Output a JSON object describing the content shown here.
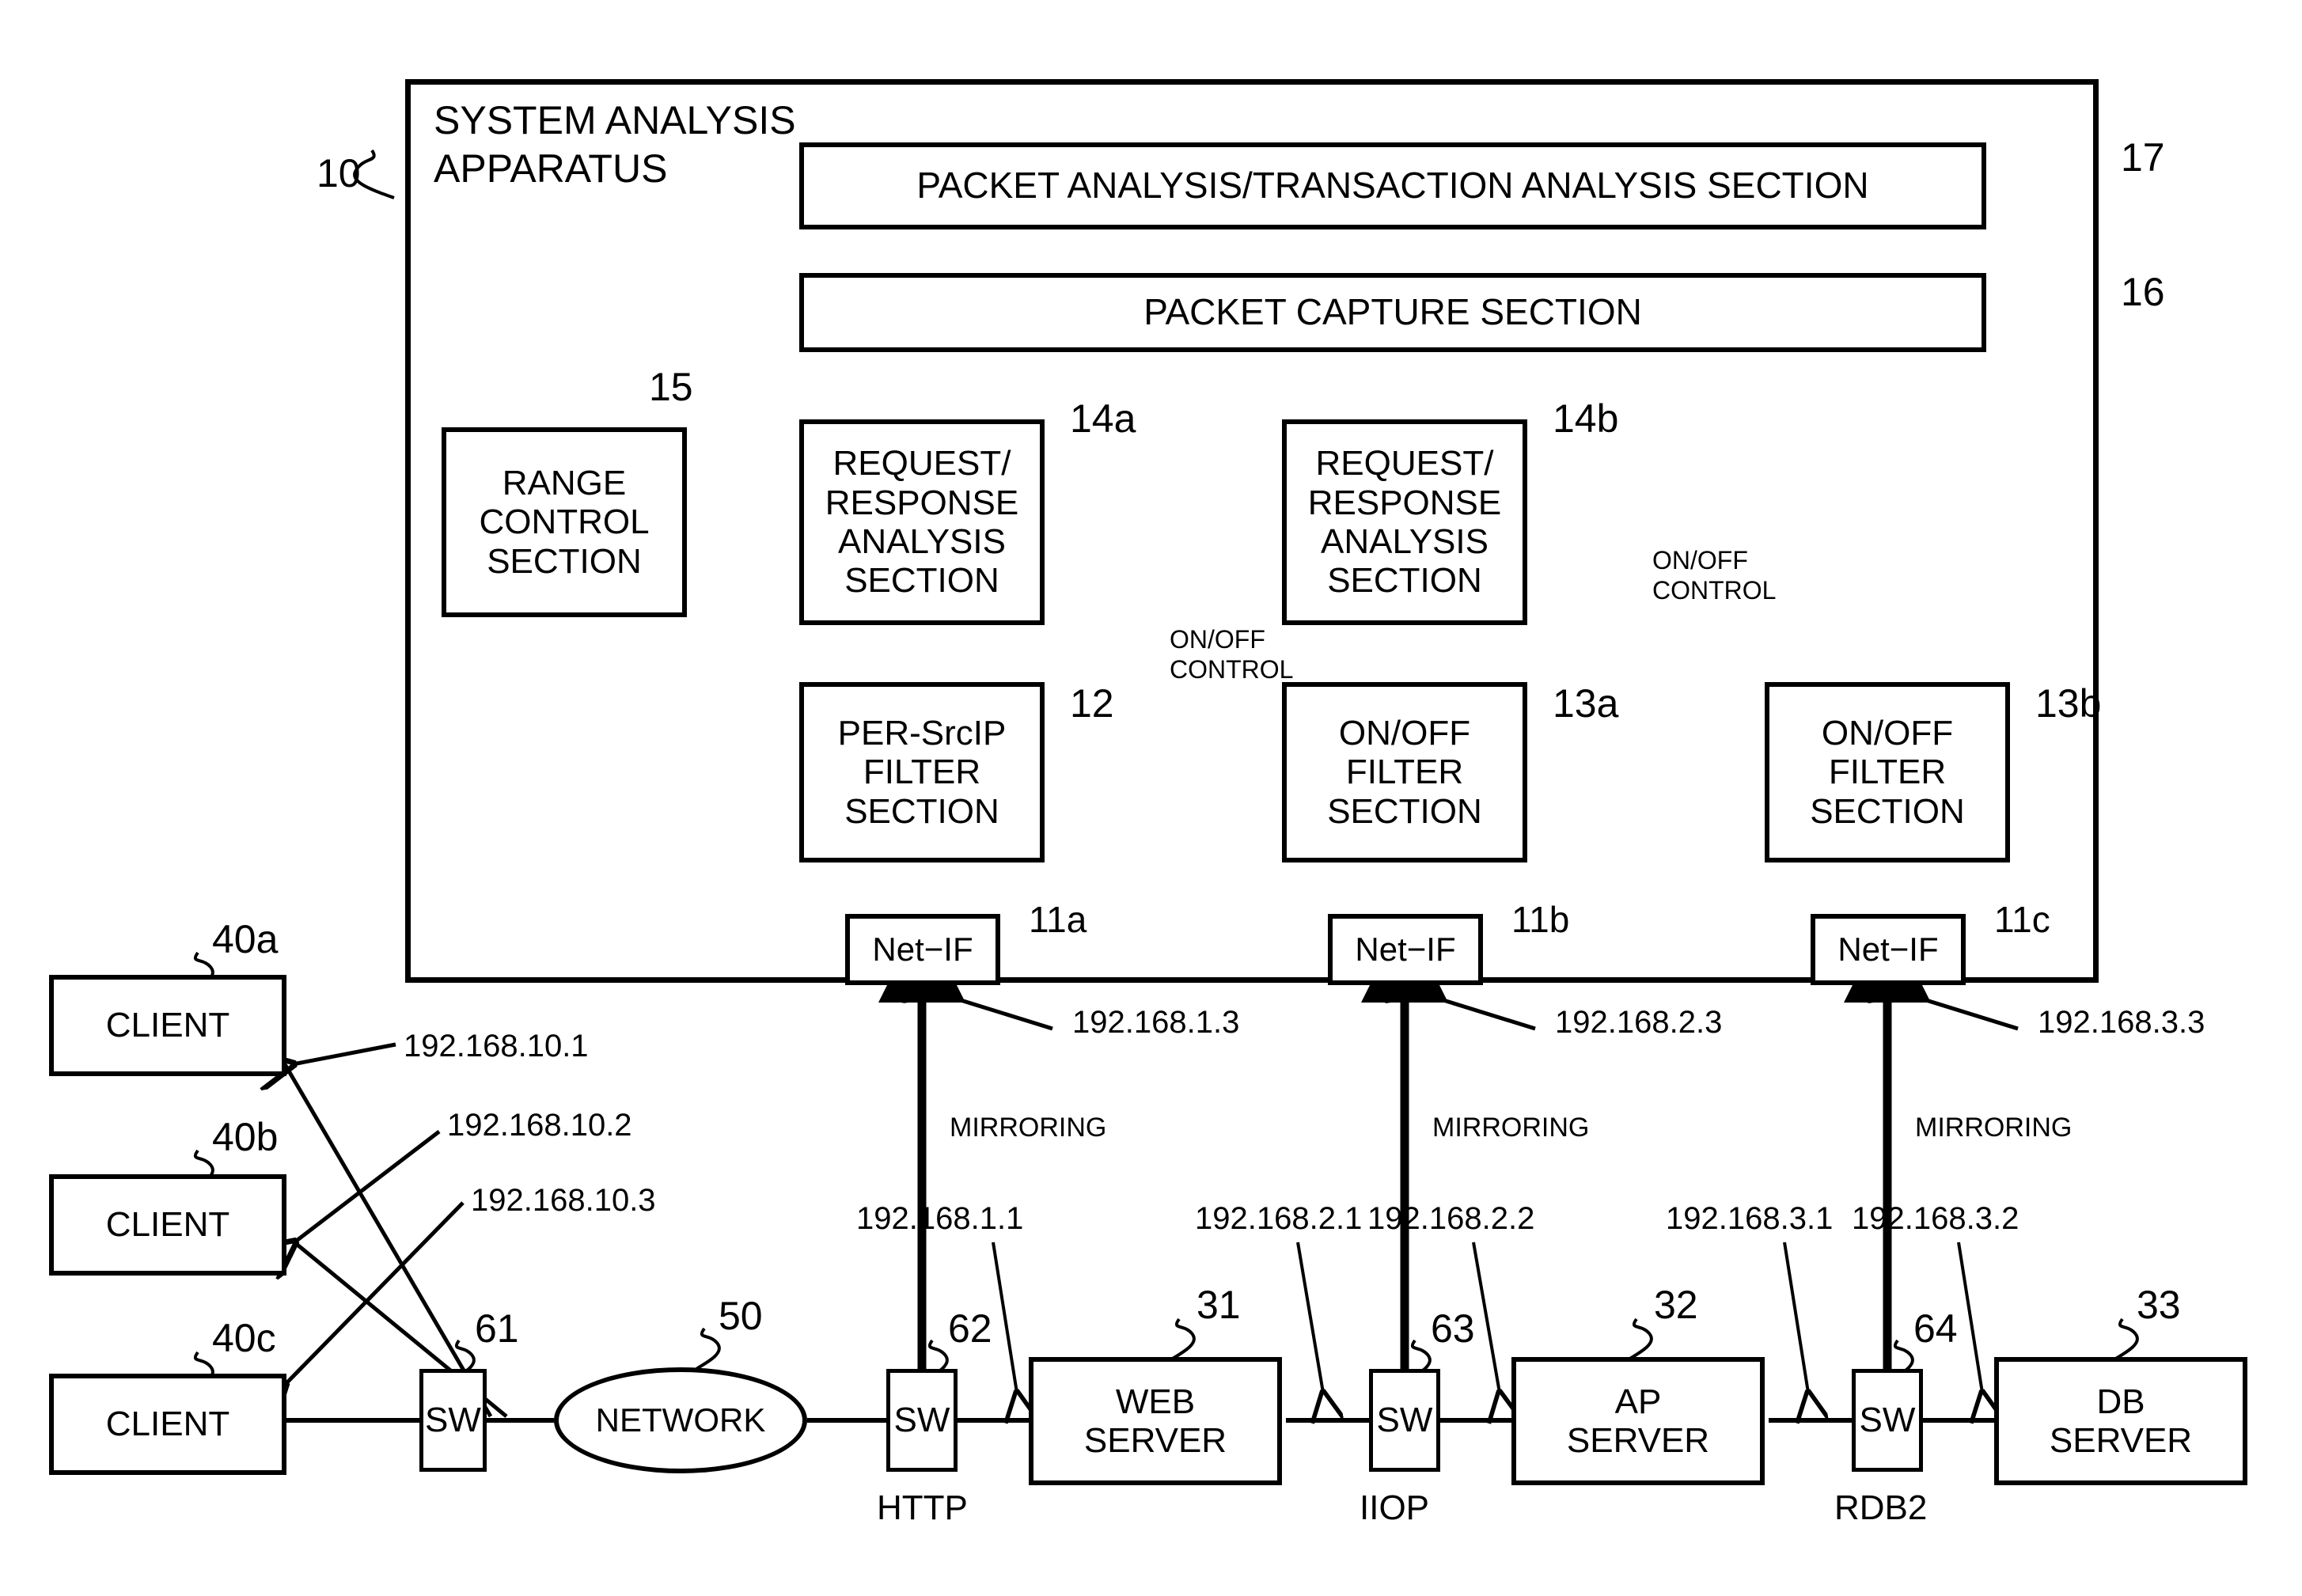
{
  "diagram": {
    "apparatus": {
      "title_line1": "SYSTEM ANALYSIS",
      "title_line2": "APPARATUS",
      "ref": "10"
    },
    "blocks": [
      {
        "id": "packet-analysis",
        "label": "PACKET ANALYSIS/TRANSACTION ANALYSIS SECTION",
        "ref": "17"
      },
      {
        "id": "packet-capture",
        "label": "PACKET CAPTURE SECTION",
        "ref": "16"
      },
      {
        "id": "range-control",
        "label": "RANGE\nCONTROL\nSECTION",
        "ref": "15"
      },
      {
        "id": "req-resp-a",
        "label": "REQUEST/\nRESPONSE\nANALYSIS\nSECTION",
        "ref": "14a"
      },
      {
        "id": "req-resp-b",
        "label": "REQUEST/\nRESPONSE\nANALYSIS\nSECTION",
        "ref": "14b"
      },
      {
        "id": "per-srcip-filter",
        "label": "PER-SrcIP\nFILTER\nSECTION",
        "ref": "12"
      },
      {
        "id": "onoff-filter-a",
        "label": "ON/OFF\nFILTER\nSECTION",
        "ref": "13a"
      },
      {
        "id": "onoff-filter-b",
        "label": "ON/OFF\nFILTER\nSECTION",
        "ref": "13b"
      },
      {
        "id": "net-if-a",
        "label": "Net−IF",
        "ref": "11a"
      },
      {
        "id": "net-if-b",
        "label": "Net−IF",
        "ref": "11b"
      },
      {
        "id": "net-if-c",
        "label": "Net−IF",
        "ref": "11c"
      }
    ],
    "control_labels": [
      {
        "id": "onoff-control-1",
        "line1": "ON/OFF",
        "line2": "CONTROL"
      },
      {
        "id": "onoff-control-2",
        "line1": "ON/OFF",
        "line2": "CONTROL"
      }
    ],
    "mirroring_labels": [
      "MIRRORING",
      "MIRRORING",
      "MIRRORING"
    ],
    "clients": [
      {
        "label": "CLIENT",
        "ref": "40a",
        "ip": "192.168.10.1"
      },
      {
        "label": "CLIENT",
        "ref": "40b",
        "ip": "192.168.10.2"
      },
      {
        "label": "CLIENT",
        "ref": "40c",
        "ip": "192.168.10.3"
      }
    ],
    "network": {
      "label": "NETWORK",
      "ref": "50"
    },
    "switches": [
      {
        "label": "SW",
        "ref": "61",
        "protocol": ""
      },
      {
        "label": "SW",
        "ref": "62",
        "protocol": "HTTP"
      },
      {
        "label": "SW",
        "ref": "63",
        "protocol": "IIOP"
      },
      {
        "label": "SW",
        "ref": "64",
        "protocol": "RDB2"
      }
    ],
    "servers": [
      {
        "label": "WEB\nSERVER",
        "ref": "31"
      },
      {
        "label": "AP\nSERVER",
        "ref": "32"
      },
      {
        "label": "DB\nSERVER",
        "ref": "33"
      }
    ],
    "netif_ips": [
      "192.168.1.3",
      "192.168.2.3",
      "192.168.3.3"
    ],
    "server_ips": [
      "192.168.1.1",
      "192.168.2.1",
      "192.168.2.2",
      "192.168.3.1",
      "192.168.3.2"
    ]
  }
}
